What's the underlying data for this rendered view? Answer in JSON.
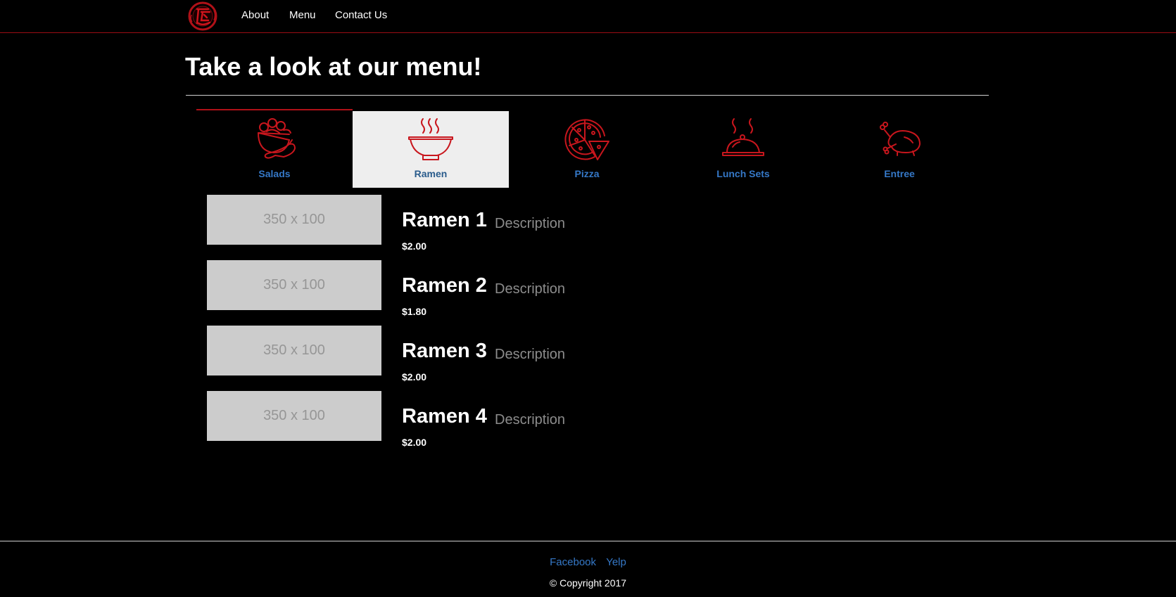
{
  "nav": {
    "links": [
      "About",
      "Menu",
      "Contact Us"
    ]
  },
  "page": {
    "title": "Take a look at our menu!"
  },
  "tabs": [
    {
      "label": "Salads",
      "icon": "salad-icon",
      "active": false
    },
    {
      "label": "Ramen",
      "icon": "ramen-bowl-icon",
      "active": true
    },
    {
      "label": "Pizza",
      "icon": "pizza-icon",
      "active": false
    },
    {
      "label": "Lunch Sets",
      "icon": "cloche-icon",
      "active": false
    },
    {
      "label": "Entree",
      "icon": "roast-chicken-icon",
      "active": false
    }
  ],
  "menu_items": [
    {
      "image_text": "350 x 100",
      "name": "Ramen 1",
      "description": "Description",
      "price": "$2.00"
    },
    {
      "image_text": "350 x 100",
      "name": "Ramen 2",
      "description": "Description",
      "price": "$1.80"
    },
    {
      "image_text": "350 x 100",
      "name": "Ramen 3",
      "description": "Description",
      "price": "$2.00"
    },
    {
      "image_text": "350 x 100",
      "name": "Ramen 4",
      "description": "Description",
      "price": "$2.00"
    }
  ],
  "footer": {
    "links": [
      "Facebook",
      "Yelp"
    ],
    "copyright": "© Copyright 2017"
  },
  "colors": {
    "background": "#000000",
    "accent_red": "#b01118",
    "link_blue": "#3578c7",
    "active_tab_bg": "#eeeeee"
  }
}
